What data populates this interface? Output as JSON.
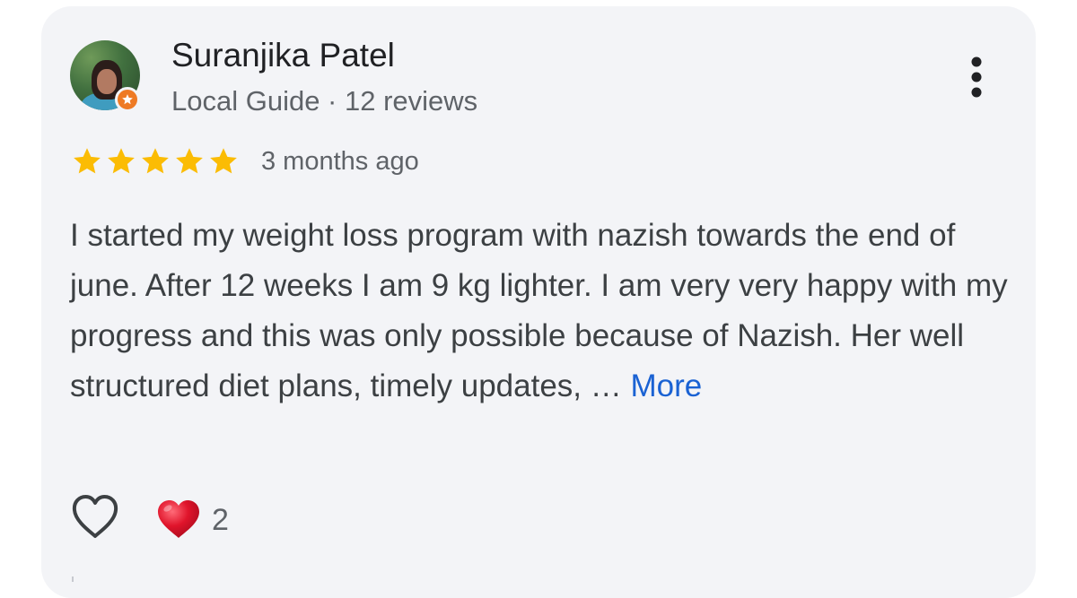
{
  "review": {
    "author": {
      "name": "Suranjika Patel",
      "meta": "Local Guide · 12 reviews"
    },
    "rating": 5,
    "time": "3 months ago",
    "text": "I started my weight loss program with nazish towards the end of june. After 12 weeks I am 9 kg lighter. I am very very happy with my progress and this was only possible because of Nazish. Her well structured diet plans, timely updates, … ",
    "more_label": "More",
    "reactions": {
      "count": "2",
      "like_icon": "heart-outline-icon",
      "reaction_icon": "red-heart-icon"
    }
  },
  "icons": {
    "menu": "more-vert-icon",
    "badge": "local-guide-badge-icon",
    "star": "star-icon"
  },
  "colors": {
    "card_background": "#f3f4f7",
    "star": "#fbbc04",
    "link": "#1a62d3",
    "heart": "#e0142b"
  }
}
